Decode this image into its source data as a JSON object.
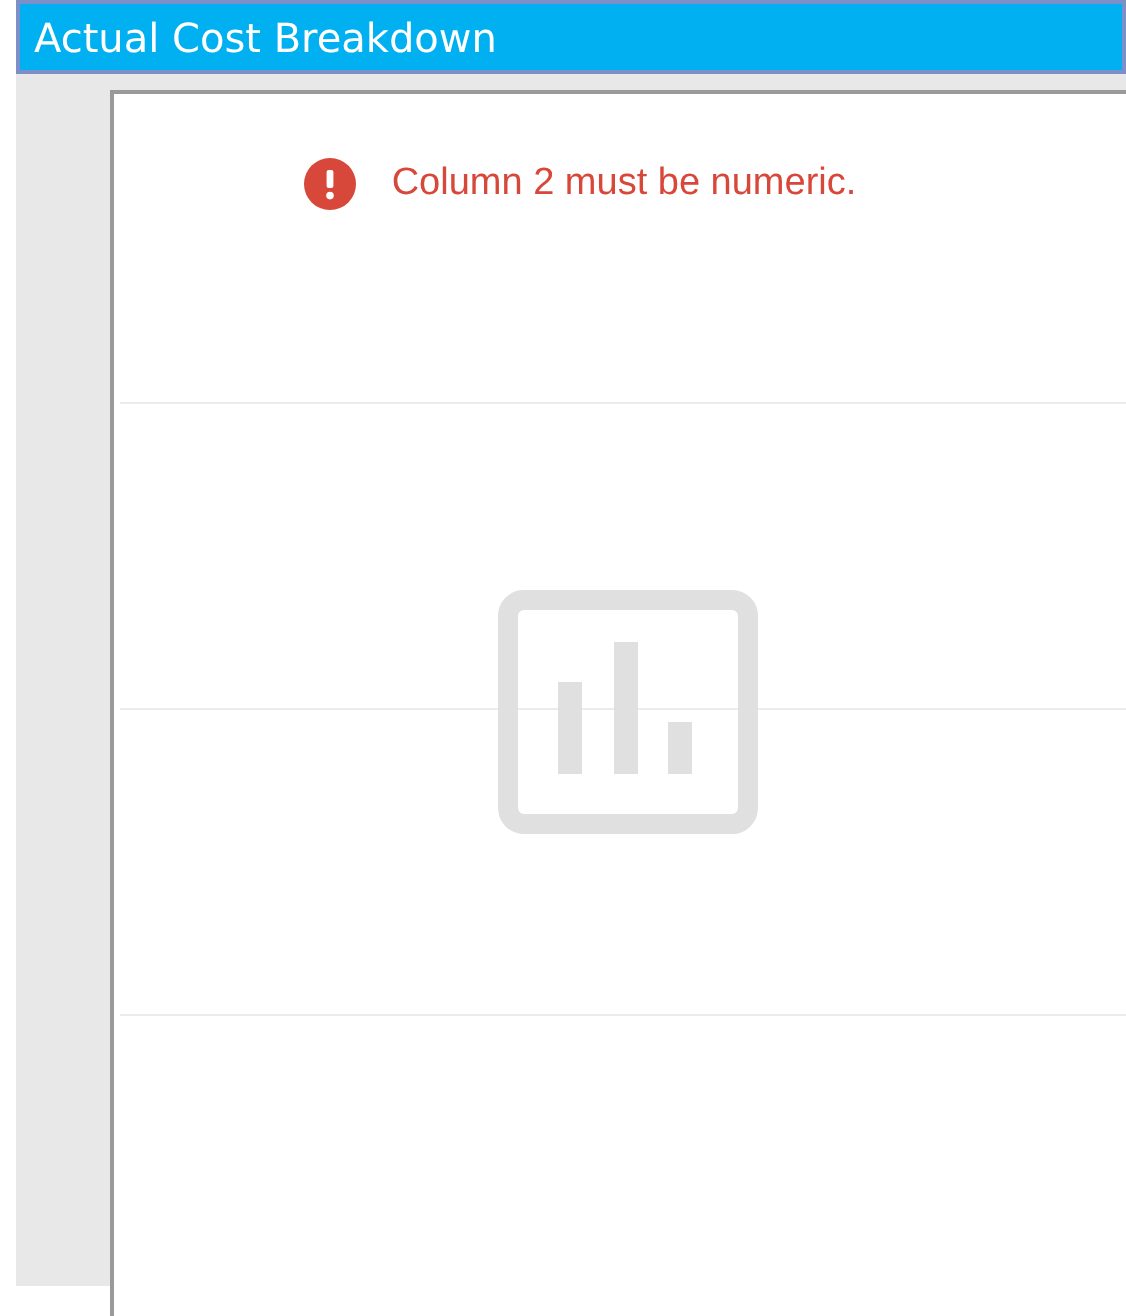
{
  "window": {
    "title": "Actual Cost Breakdown"
  },
  "chart": {
    "error": "Column 2 must be numeric."
  }
}
